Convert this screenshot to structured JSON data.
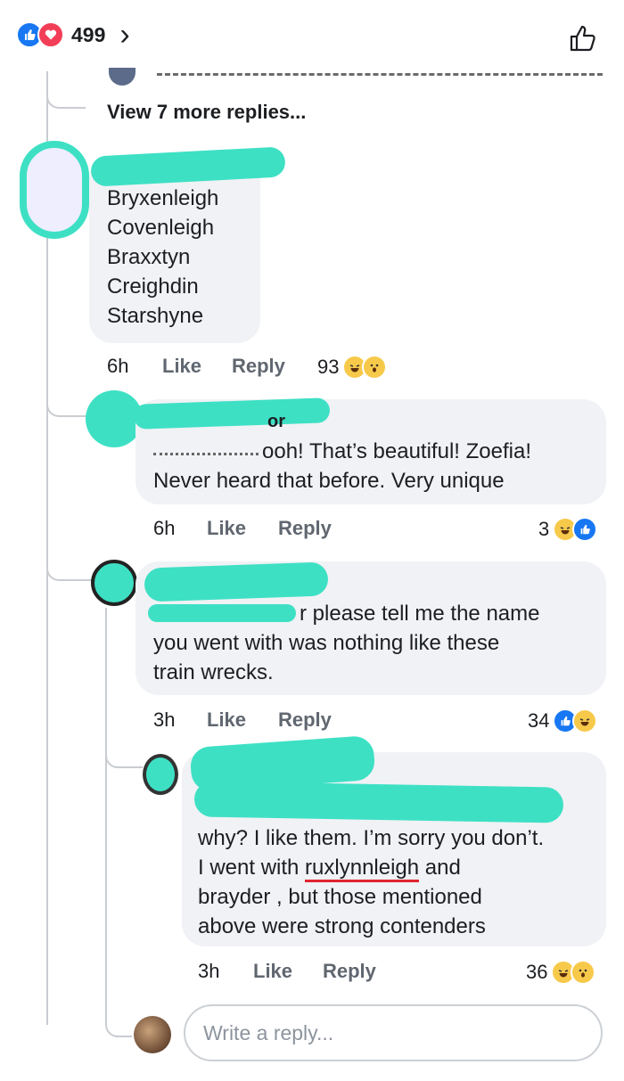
{
  "header": {
    "reaction_count": "499",
    "chevron": "›",
    "like_icon": "thumbs-up-outline-icon"
  },
  "thread": {
    "view_more": "View 7 more replies..."
  },
  "comments": [
    {
      "lines": [
        "Bryxenleigh",
        "Covenleigh",
        "Braxxtyn",
        "Creighdin",
        "Starshyne"
      ],
      "time": "6h",
      "like": "Like",
      "reply": "Reply",
      "reactions": "93"
    },
    {
      "name_fragment": "or",
      "lines": [
        "ooh! That’s beautiful! Zoefia!",
        "Never heard that before. Very unique"
      ],
      "time": "6h",
      "like": "Like",
      "reply": "Reply",
      "reactions": "3"
    },
    {
      "lines": [
        "r please tell me the name",
        "you went with was nothing like these",
        "train wrecks."
      ],
      "time": "3h",
      "like": "Like",
      "reply": "Reply",
      "reactions": "34"
    },
    {
      "line1": "why? I like them. I’m sorry you don’t.",
      "line2_pre": "I went with ",
      "line2_under": "ruxlynnleigh",
      "line2_post": " and",
      "line3": "brayder , but those mentioned",
      "line4": "above were strong contenders",
      "time": "3h",
      "like": "Like",
      "reply": "Reply",
      "reactions": "36"
    }
  ],
  "composer": {
    "placeholder": "Write a reply..."
  },
  "colors": {
    "redaction": "#3ee0c4",
    "bubble": "#f0f2f5",
    "like_blue": "#1877f2",
    "love_red": "#f33e58",
    "underline_red": "#e0242f"
  }
}
